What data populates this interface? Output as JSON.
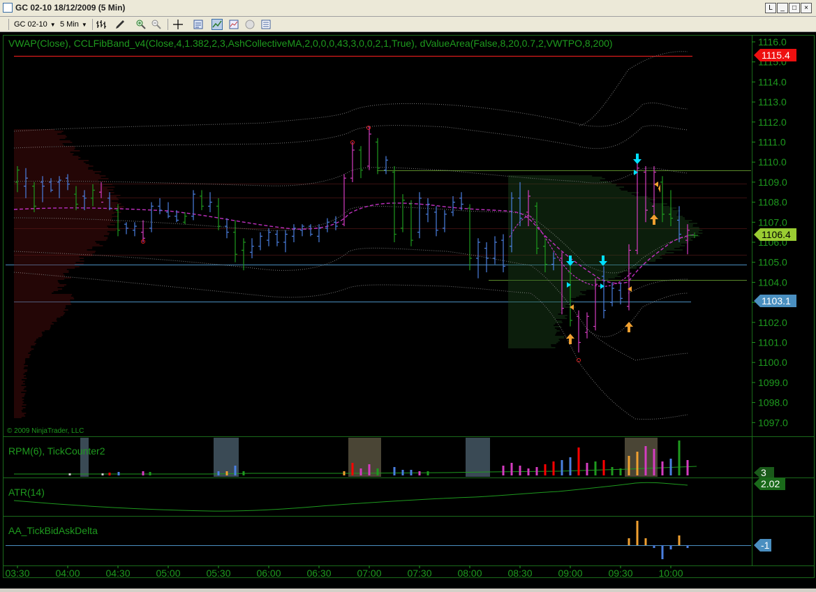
{
  "window": {
    "title": "GC 02-10  18/12/2009 (5 Min)"
  },
  "toolbar": {
    "instrument": "GC 02-10",
    "interval": "5 Min"
  },
  "chart": {
    "indicators_label": "VWAP(Close),  CCLFibBand_v4(Close,4,1.382,2,3,AshCollectiveMA,2,0,0,0,43,3,0,0,2,1,True),  dValueArea(False,8,20,0.7,2,VWTPO,8,200)",
    "copyright": "© 2009 NinjaTrader, LLC",
    "price_ticks": [
      "1116.0",
      "1115.0",
      "1114.0",
      "1113.0",
      "1112.0",
      "1111.0",
      "1110.0",
      "1109.0",
      "1108.0",
      "1107.0",
      "1106.0",
      "1105.0",
      "1104.0",
      "1103.0",
      "1102.0",
      "1101.0",
      "1100.0",
      "1099.0",
      "1098.0",
      "1097.0"
    ],
    "markers": {
      "high": "1115.4",
      "last": "1106.4",
      "low": "1103.1"
    },
    "time_ticks": [
      "03:30",
      "04:00",
      "04:30",
      "05:00",
      "05:30",
      "06:00",
      "06:30",
      "07:00",
      "07:30",
      "08:00",
      "08:30",
      "09:00",
      "09:30",
      "10:00"
    ]
  },
  "panels": {
    "rpm": {
      "label": "RPM(6), TickCounter2",
      "value": "3"
    },
    "atr": {
      "label": "ATR(14)",
      "value": "2.02"
    },
    "delta": {
      "label": "AA_TickBidAskDelta",
      "value": "-1"
    }
  },
  "colors": {
    "bg": "#000000",
    "text_green": "#1e9a1e",
    "up_bar": "#1e9a1e",
    "down_bar": "#4a7fe0",
    "vwap": "#c030c0",
    "high_marker": "#ff0000",
    "last_marker": "#9acd32",
    "low_marker": "#4a8fc0"
  }
}
